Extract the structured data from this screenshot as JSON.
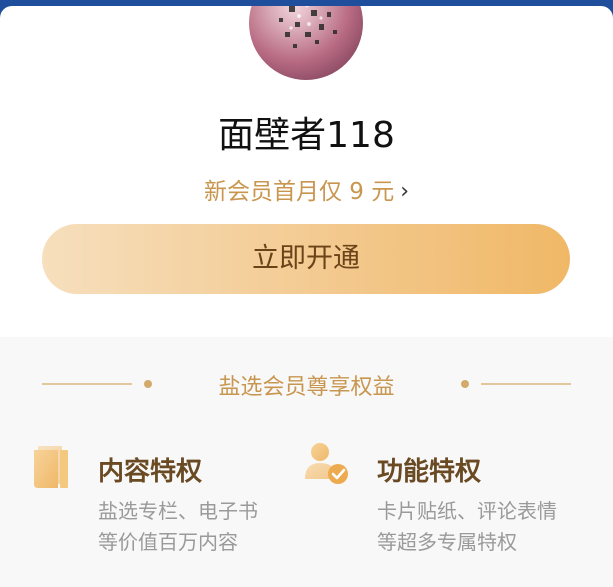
{
  "profile": {
    "username": "面壁者118",
    "promo_text": "新会员首月仅 9 元",
    "promo_chevron": "›",
    "avatar_icon": "avatar-image"
  },
  "cta": {
    "label": "立即开通"
  },
  "benefits": {
    "title": "盐选会员尊享权益",
    "items": [
      {
        "icon": "book-icon",
        "title": "内容特权",
        "desc_line1": "盐选专栏、电子书",
        "desc_line2": "等价值百万内容"
      },
      {
        "icon": "user-check-icon",
        "title": "功能特权",
        "desc_line1": "卡片贴纸、评论表情",
        "desc_line2": "等超多专属特权"
      }
    ]
  },
  "colors": {
    "page_border": "#1f4e9c",
    "accent": "#c9964f",
    "button_gradient_start": "#f6dfbd",
    "button_gradient_end": "#f0b866",
    "feature_title": "#6a4a23",
    "muted_text": "#9a9a9a"
  }
}
